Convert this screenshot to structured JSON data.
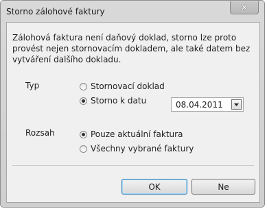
{
  "window": {
    "title": "Storno zálohové faktury",
    "close_glyph": "✕"
  },
  "message": "Zálohová faktura není daňový doklad, storno lze proto provést nejen stornovacím dokladem, ale také datem bez vytváření dalšího dokladu.",
  "typ": {
    "label": "Typ",
    "options": [
      {
        "label": "Stornovací doklad",
        "checked": false
      },
      {
        "label": "Storno k datu",
        "checked": true
      }
    ],
    "date_value": "08.04.2011"
  },
  "rozsah": {
    "label": "Rozsah",
    "options": [
      {
        "label": "Pouze aktuální faktura",
        "checked": true
      },
      {
        "label": "Všechny vybrané faktury",
        "checked": false
      }
    ]
  },
  "buttons": {
    "ok": "OK",
    "no": "Ne"
  }
}
